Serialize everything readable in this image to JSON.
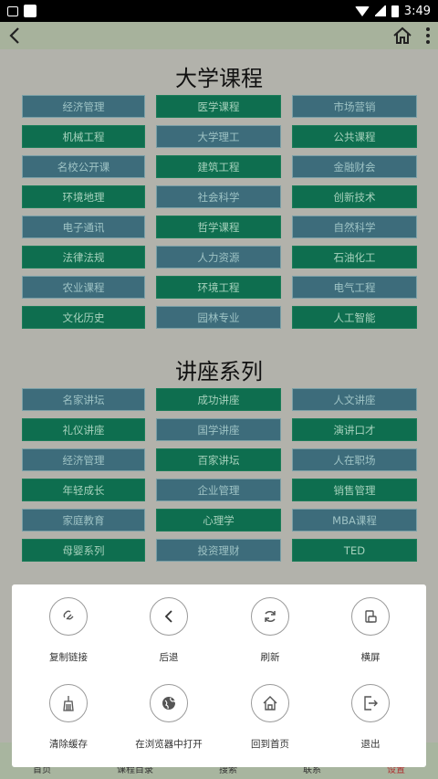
{
  "status_bar": {
    "time": "3:49"
  },
  "header": {
    "back_icon": "chevron-left-icon",
    "home_icon": "home-icon",
    "menu_icon": "more-vertical-icon"
  },
  "courses": {
    "title": "大学课程",
    "items": [
      {
        "label": "经济管理",
        "color": "blue"
      },
      {
        "label": "医学课程",
        "color": "green"
      },
      {
        "label": "市场营销",
        "color": "blue"
      },
      {
        "label": "机械工程",
        "color": "green"
      },
      {
        "label": "大学理工",
        "color": "blue"
      },
      {
        "label": "公共课程",
        "color": "green"
      },
      {
        "label": "名校公开课",
        "color": "blue"
      },
      {
        "label": "建筑工程",
        "color": "green"
      },
      {
        "label": "金融财会",
        "color": "blue"
      },
      {
        "label": "环境地理",
        "color": "green"
      },
      {
        "label": "社会科学",
        "color": "blue"
      },
      {
        "label": "创新技术",
        "color": "green"
      },
      {
        "label": "电子通讯",
        "color": "blue"
      },
      {
        "label": "哲学课程",
        "color": "green"
      },
      {
        "label": "自然科学",
        "color": "blue"
      },
      {
        "label": "法律法规",
        "color": "green"
      },
      {
        "label": "人力资源",
        "color": "blue"
      },
      {
        "label": "石油化工",
        "color": "green"
      },
      {
        "label": "农业课程",
        "color": "blue"
      },
      {
        "label": "环境工程",
        "color": "green"
      },
      {
        "label": "电气工程",
        "color": "blue"
      },
      {
        "label": "文化历史",
        "color": "green"
      },
      {
        "label": "园林专业",
        "color": "blue"
      },
      {
        "label": "人工智能",
        "color": "green"
      }
    ]
  },
  "lectures": {
    "title": "讲座系列",
    "items": [
      {
        "label": "名家讲坛",
        "color": "blue"
      },
      {
        "label": "成功讲座",
        "color": "green"
      },
      {
        "label": "人文讲座",
        "color": "blue"
      },
      {
        "label": "礼仪讲座",
        "color": "green"
      },
      {
        "label": "国学讲座",
        "color": "blue"
      },
      {
        "label": "演讲口才",
        "color": "green"
      },
      {
        "label": "经济管理",
        "color": "blue"
      },
      {
        "label": "百家讲坛",
        "color": "green"
      },
      {
        "label": "人在职场",
        "color": "blue"
      },
      {
        "label": "年轻成长",
        "color": "green"
      },
      {
        "label": "企业管理",
        "color": "blue"
      },
      {
        "label": "销售管理",
        "color": "green"
      },
      {
        "label": "家庭教育",
        "color": "blue"
      },
      {
        "label": "心理学",
        "color": "green"
      },
      {
        "label": "MBA课程",
        "color": "blue"
      },
      {
        "label": "母婴系列",
        "color": "green"
      },
      {
        "label": "投资理财",
        "color": "blue"
      },
      {
        "label": "TED",
        "color": "green"
      }
    ]
  },
  "tabbar": {
    "items": [
      "首页",
      "课程目录",
      "搜索",
      "联系",
      "设置"
    ],
    "active_index": 4
  },
  "sheet": {
    "actions": [
      {
        "label": "复制链接",
        "icon": "link-icon"
      },
      {
        "label": "后退",
        "icon": "chevron-left-icon"
      },
      {
        "label": "刷新",
        "icon": "refresh-icon"
      },
      {
        "label": "横屏",
        "icon": "rotate-screen-icon"
      },
      {
        "label": "清除缓存",
        "icon": "broom-icon"
      },
      {
        "label": "在浏览器中打开",
        "icon": "globe-icon"
      },
      {
        "label": "回到首页",
        "icon": "home-icon"
      },
      {
        "label": "退出",
        "icon": "exit-icon"
      }
    ]
  }
}
